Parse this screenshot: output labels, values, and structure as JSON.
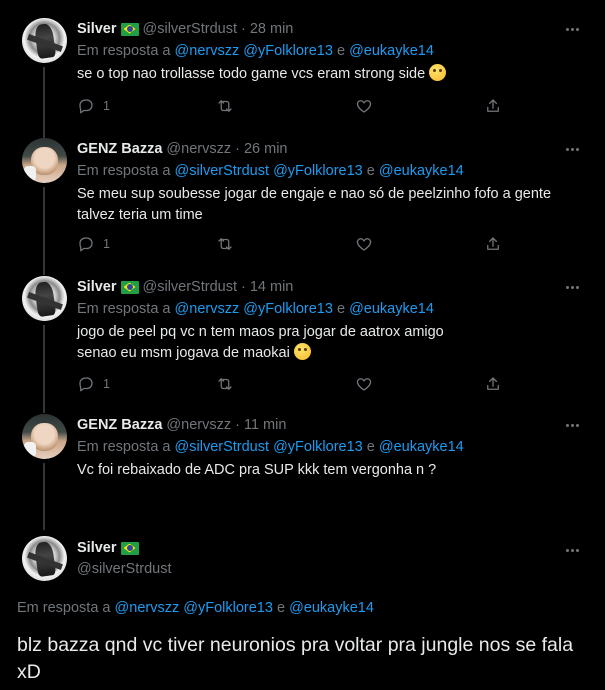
{
  "replies": [
    {
      "name": "Silver",
      "has_flag": true,
      "handle": "@silverStrdust",
      "dot": "·",
      "time": "28 min",
      "reply_prefix": "Em resposta a",
      "mentions": [
        "@nervszz",
        "@yFolklore13"
      ],
      "conj": "e",
      "last_mention": "@eukayke14",
      "text": "se o top nao trollasse todo game vcs eram strong side",
      "emoji": "zany-face",
      "reply_count": "1"
    },
    {
      "name": "GENZ Bazza",
      "has_flag": false,
      "handle": "@nervszz",
      "dot": "·",
      "time": "26 min",
      "reply_prefix": "Em resposta a",
      "mentions": [
        "@silverStrdust",
        "@yFolklore13"
      ],
      "conj": "e",
      "last_mention": "@eukayke14",
      "text": "Se meu sup soubesse jogar de engaje e nao só de peelzinho fofo a gente talvez teria um time",
      "reply_count": "1"
    },
    {
      "name": "Silver",
      "has_flag": true,
      "handle": "@silverStrdust",
      "dot": "·",
      "time": "14 min",
      "reply_prefix": "Em resposta a",
      "mentions": [
        "@nervszz",
        "@yFolklore13"
      ],
      "conj": "e",
      "last_mention": "@eukayke14",
      "text_line1": "jogo de peel pq vc n tem maos pra jogar de aatrox amigo",
      "text_line2": "senao eu msm jogava de maokai",
      "emoji": "face-without-mouth",
      "reply_count": "1"
    },
    {
      "name": "GENZ Bazza",
      "has_flag": false,
      "handle": "@nervszz",
      "dot": "·",
      "time": "11 min",
      "reply_prefix": "Em resposta a",
      "mentions": [
        "@silverStrdust",
        "@yFolklore13"
      ],
      "conj": "e",
      "last_mention": "@eukayke14",
      "text": "Vc foi rebaixado de ADC pra SUP kkk tem vergonha n ?"
    }
  ],
  "main_tweet": {
    "name": "Silver",
    "has_flag": true,
    "handle": "@silverStrdust",
    "reply_prefix": "Em resposta a",
    "mentions": [
      "@nervszz",
      "@yFolklore13"
    ],
    "conj": "e",
    "last_mention": "@eukayke14",
    "text": "blz bazza qnd vc tiver neuronios pra voltar pra jungle nos se fala xD"
  },
  "icons": [
    "reply-icon",
    "retweet-icon",
    "like-icon",
    "share-icon",
    "more-icon",
    "brazil-flag-icon"
  ],
  "colors": {
    "background": "#000000",
    "text": "#e7e9ea",
    "muted": "#71767b",
    "accent": "#1d9bf0",
    "divider": "#333639"
  }
}
